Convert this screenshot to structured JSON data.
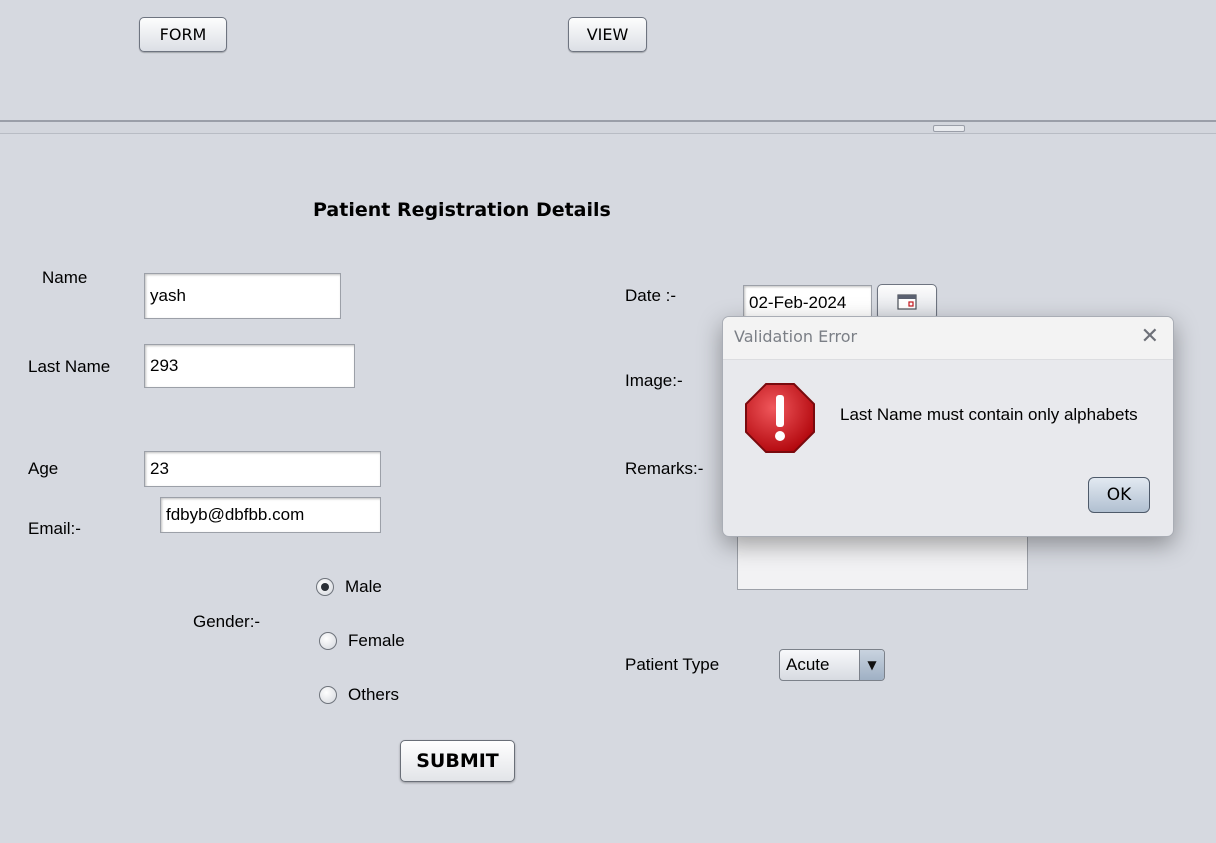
{
  "toolbar": {
    "form_label": "FORM",
    "view_label": "VIEW"
  },
  "form": {
    "title": "Patient Registration Details",
    "name_label": "Name",
    "name_value": "yash",
    "last_name_label": "Last Name",
    "last_name_value": "293",
    "age_label": "Age",
    "age_value": "23",
    "email_label": "Email:-",
    "email_value": "fdbyb@dbfbb.com",
    "gender_label": "Gender:-",
    "gender_options": [
      "Male",
      "Female",
      "Others"
    ],
    "gender_selected": "Male",
    "submit_label": "SUBMIT",
    "date_label": "Date :-",
    "date_value": "02-Feb-2024",
    "image_label": "Image:-",
    "remarks_label": "Remarks:-",
    "patient_type_label": "Patient Type",
    "patient_type_value": "Acute"
  },
  "dialog": {
    "title": "Validation Error",
    "message": "Last Name must contain only alphabets",
    "ok_label": "OK",
    "icon": "error-icon"
  },
  "colors": {
    "background": "#d6d9e0",
    "error_red": "#c4161c",
    "dialog_bg": "#e8e9ed"
  }
}
